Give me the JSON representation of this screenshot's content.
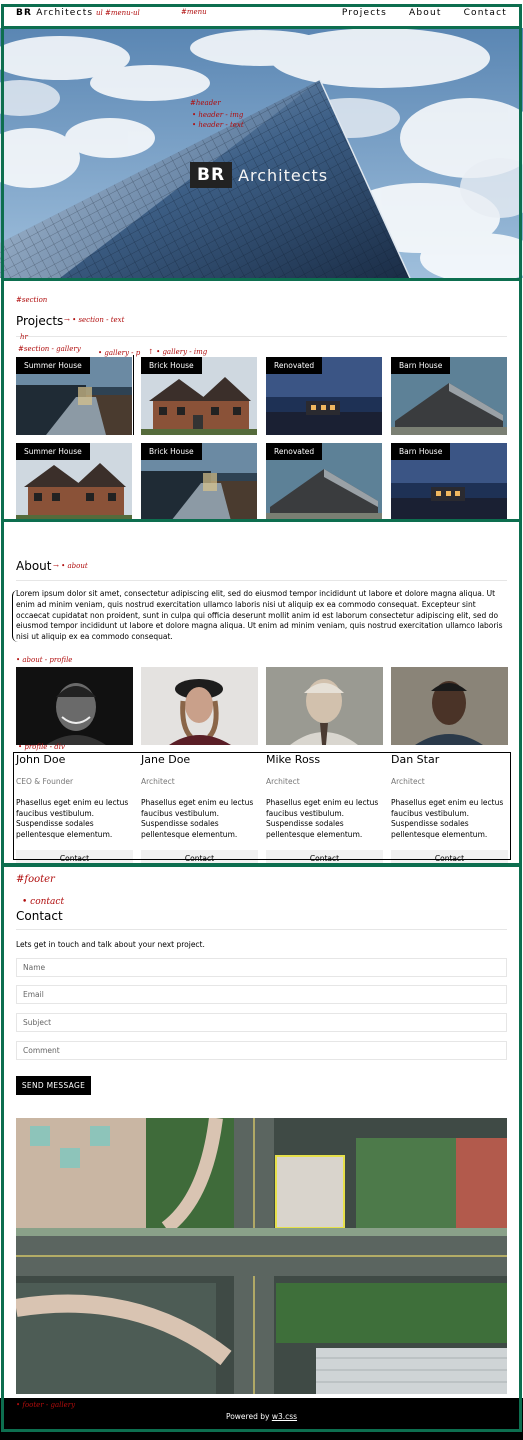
{
  "nav": {
    "brand_bold": "BR",
    "brand_rest": "Architects",
    "links": [
      "Projects",
      "About",
      "Contact"
    ]
  },
  "hero": {
    "logo_box": "BR",
    "logo_word": "Architects"
  },
  "projects": {
    "title": "Projects",
    "items": [
      {
        "label": "Summer House"
      },
      {
        "label": "Brick House"
      },
      {
        "label": "Renovated"
      },
      {
        "label": "Barn House"
      },
      {
        "label": "Summer House"
      },
      {
        "label": "Brick House"
      },
      {
        "label": "Renovated"
      },
      {
        "label": "Barn House"
      }
    ]
  },
  "about": {
    "title": "About",
    "text": "Lorem ipsum dolor sit amet, consectetur adipiscing elit, sed do eiusmod tempor incididunt ut labore et dolore magna aliqua. Ut enim ad minim veniam, quis nostrud exercitation ullamco laboris nisi ut aliquip ex ea commodo consequat. Excepteur sint occaecat cupidatat non proident, sunt in culpa qui officia deserunt mollit anim id est laborum consectetur adipiscing elit, sed do eiusmod tempor incididunt ut labore et dolore magna aliqua. Ut enim ad minim veniam, quis nostrud exercitation ullamco laboris nisi ut aliquip ex ea commodo consequat.",
    "team": [
      {
        "name": "John Doe",
        "role": "CEO & Founder",
        "desc": "Phasellus eget enim eu lectus faucibus vestibulum. Suspendisse sodales pellentesque elementum.",
        "button": "Contact"
      },
      {
        "name": "Jane Doe",
        "role": "Architect",
        "desc": "Phasellus eget enim eu lectus faucibus vestibulum. Suspendisse sodales pellentesque elementum.",
        "button": "Contact"
      },
      {
        "name": "Mike Ross",
        "role": "Architect",
        "desc": "Phasellus eget enim eu lectus faucibus vestibulum. Suspendisse sodales pellentesque elementum.",
        "button": "Contact"
      },
      {
        "name": "Dan Star",
        "role": "Architect",
        "desc": "Phasellus eget enim eu lectus faucibus vestibulum. Suspendisse sodales pellentesque elementum.",
        "button": "Contact"
      }
    ]
  },
  "contact": {
    "title": "Contact",
    "intro": "Lets get in touch and talk about your next project.",
    "fields": {
      "name_placeholder": "Name",
      "email_placeholder": "Email",
      "subject_placeholder": "Subject",
      "comment_placeholder": "Comment"
    },
    "send_label": "SEND MESSAGE"
  },
  "footer": {
    "prefix": "Powered by ",
    "link": "w3.css"
  },
  "annotations": {
    "menu_ul": "ul #menu-ul",
    "menu": "#menu",
    "header": "#header",
    "header_img": "• header - img",
    "header_text": "• header - text",
    "section": "#section",
    "section_text": "→ • section - text",
    "hr": "hr",
    "section_gallery": "#section - gallery",
    "gallery_p": "• gallery - p",
    "gallery_img": "↑ • gallery - img",
    "about": "→ • about",
    "about_profile": "• about - profile",
    "profile_div": "• profile - div",
    "footer": "#footer",
    "contact": "• contact",
    "footer_gallery": "• footer - gallery"
  },
  "colors": {
    "frame": "#0d6e4f",
    "annotation": "#b00d0d",
    "button_bg": "#f1f1f1"
  }
}
